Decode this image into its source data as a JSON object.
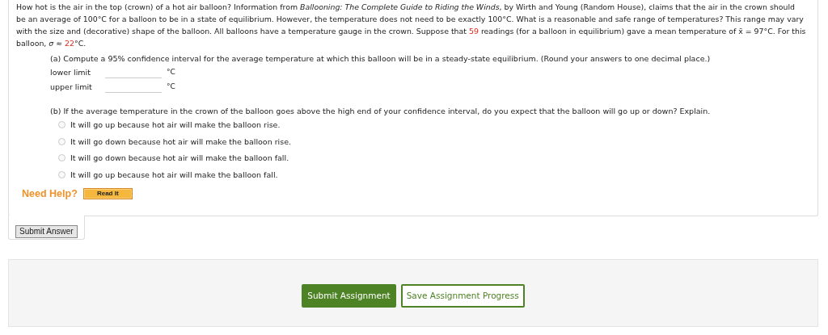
{
  "question": {
    "intro": [
      {
        "kind": "text",
        "text": "How hot is the air in the top (crown) of a hot air balloon? Information from *Ballooning: The Complete Guide to Riding the Winds*, by Wirth and Young (Random House), claims that the air in the crown should be an average of 100°C for a balloon to be in a state of equilibrium. However, the temperature does not need to be exactly 100°C. What is a reasonable and safe range of temperatures? This range may vary with the size and (decorative) shape of the balloon. All balloons have a temperature gauge in the crown. Suppose that "
      },
      {
        "kind": "given",
        "text": "59"
      },
      {
        "kind": "text",
        "text": " readings (for a balloon in equilibrium) gave a mean temperature of x̄ = 97°C. For this balloon, *σ* ≈ "
      },
      {
        "kind": "given",
        "text": "22"
      },
      {
        "kind": "text",
        "text": "°C."
      }
    ],
    "part_a": {
      "prompt": "(a) Compute a 95% confidence interval for the average temperature at which this balloon will be in a steady-state equilibrium. (Round your answers to one decimal place.)",
      "fields": [
        {
          "label": "lower limit",
          "unit": "°C"
        },
        {
          "label": "upper limit",
          "unit": "°C"
        }
      ]
    },
    "part_b": {
      "prompt": "(b) If the average temperature in the crown of the balloon goes above the high end of your confidence interval, do you expect that the balloon will go up or down? Explain.",
      "options": [
        {
          "label": "It will go up because hot air will make the balloon rise.",
          "selected": false
        },
        {
          "label": "It will go down because hot air will make the balloon rise.",
          "selected": false
        },
        {
          "label": "It will go down because hot air will make the balloon fall.",
          "selected": false
        },
        {
          "label": "It will go up because hot air will make the balloon fall.",
          "selected": false
        }
      ]
    },
    "help": {
      "label": "Need Help?",
      "button": "Read It"
    },
    "submit_answer": "Submit Answer"
  },
  "footer": {
    "buttons": [
      {
        "label": "Submit Assignment",
        "kind": "primary"
      },
      {
        "label": "Save Assignment Progress",
        "kind": "secondary"
      }
    ]
  }
}
